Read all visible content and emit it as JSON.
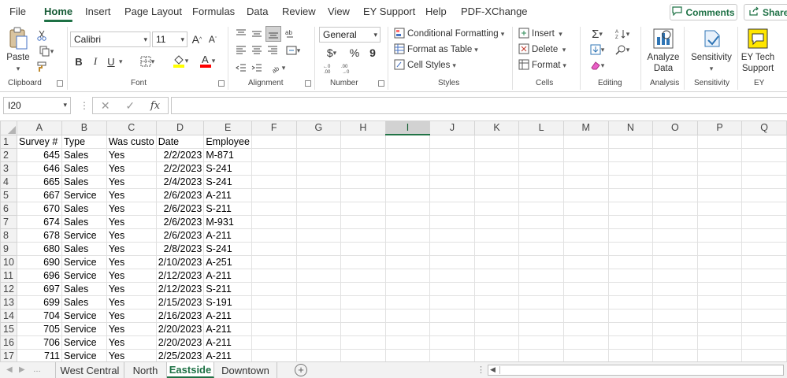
{
  "menu": {
    "tabs": [
      "File",
      "Home",
      "Insert",
      "Page Layout",
      "Formulas",
      "Data",
      "Review",
      "View",
      "EY Support",
      "Help",
      "PDF-XChange"
    ],
    "active": "Home",
    "comments_label": "Comments",
    "share_label": "Share"
  },
  "ribbon": {
    "clipboard": {
      "label": "Clipboard",
      "paste": "Paste"
    },
    "font": {
      "label": "Font",
      "name": "Calibri",
      "size": "11",
      "bold": "B",
      "italic": "I",
      "underline": "U",
      "grow": "A",
      "shrink": "A"
    },
    "alignment": {
      "label": "Alignment"
    },
    "number": {
      "label": "Number",
      "format": "General",
      "currency": "$",
      "percent": "%",
      "comma": "9"
    },
    "styles": {
      "label": "Styles",
      "conditional": "Conditional Formatting",
      "table": "Format as Table",
      "cell_styles": "Cell Styles"
    },
    "cells": {
      "label": "Cells",
      "insert": "Insert",
      "delete": "Delete",
      "format": "Format"
    },
    "editing": {
      "label": "Editing"
    },
    "analysis": {
      "label": "Analysis",
      "analyze": "Analyze Data"
    },
    "sensitivity": {
      "label": "Sensitivity",
      "button": "Sensitivity"
    },
    "ey": {
      "label": "EY",
      "button": "EY Tech Support"
    }
  },
  "formula_bar": {
    "name_box": "I20",
    "content": ""
  },
  "columns": [
    "A",
    "B",
    "C",
    "D",
    "E",
    "F",
    "G",
    "H",
    "I",
    "J",
    "K",
    "L",
    "M",
    "N",
    "O",
    "P",
    "Q"
  ],
  "selected_column": "I",
  "header_row": [
    "Survey #",
    "Type",
    "Was custo",
    "Date",
    "Employee"
  ],
  "rows": [
    [
      "645",
      "Sales",
      "Yes",
      "2/2/2023",
      "M-871"
    ],
    [
      "646",
      "Sales",
      "Yes",
      "2/2/2023",
      "S-241"
    ],
    [
      "665",
      "Sales",
      "Yes",
      "2/4/2023",
      "S-241"
    ],
    [
      "667",
      "Service",
      "Yes",
      "2/6/2023",
      "A-211"
    ],
    [
      "670",
      "Sales",
      "Yes",
      "2/6/2023",
      "S-211"
    ],
    [
      "674",
      "Sales",
      "Yes",
      "2/6/2023",
      "M-931"
    ],
    [
      "678",
      "Service",
      "Yes",
      "2/6/2023",
      "A-211"
    ],
    [
      "680",
      "Sales",
      "Yes",
      "2/8/2023",
      "S-241"
    ],
    [
      "690",
      "Service",
      "Yes",
      "2/10/2023",
      "A-251"
    ],
    [
      "696",
      "Service",
      "Yes",
      "2/12/2023",
      "A-211"
    ],
    [
      "697",
      "Sales",
      "Yes",
      "2/12/2023",
      "S-211"
    ],
    [
      "699",
      "Sales",
      "Yes",
      "2/15/2023",
      "S-191"
    ],
    [
      "704",
      "Service",
      "Yes",
      "2/16/2023",
      "A-211"
    ],
    [
      "705",
      "Service",
      "Yes",
      "2/20/2023",
      "A-211"
    ],
    [
      "706",
      "Service",
      "Yes",
      "2/20/2023",
      "A-211"
    ],
    [
      "711",
      "Service",
      "Yes",
      "2/25/2023",
      "A-211"
    ]
  ],
  "sheets": [
    "West Central",
    "North",
    "Eastside",
    "Downtown"
  ],
  "active_sheet": "Eastside",
  "colors": {
    "accent": "#1e7145",
    "brand_yellow": "#ffe600"
  },
  "icons": [
    "paste-icon",
    "cut-icon",
    "copy-icon",
    "format-painter-icon",
    "borders-icon",
    "fill-color-icon",
    "font-color-icon",
    "autosum-icon",
    "sort-filter-icon",
    "find-icon",
    "clear-icon",
    "analyze-data-icon",
    "sensitivity-icon",
    "ey-tech-support-icon",
    "comments-icon",
    "share-icon"
  ]
}
